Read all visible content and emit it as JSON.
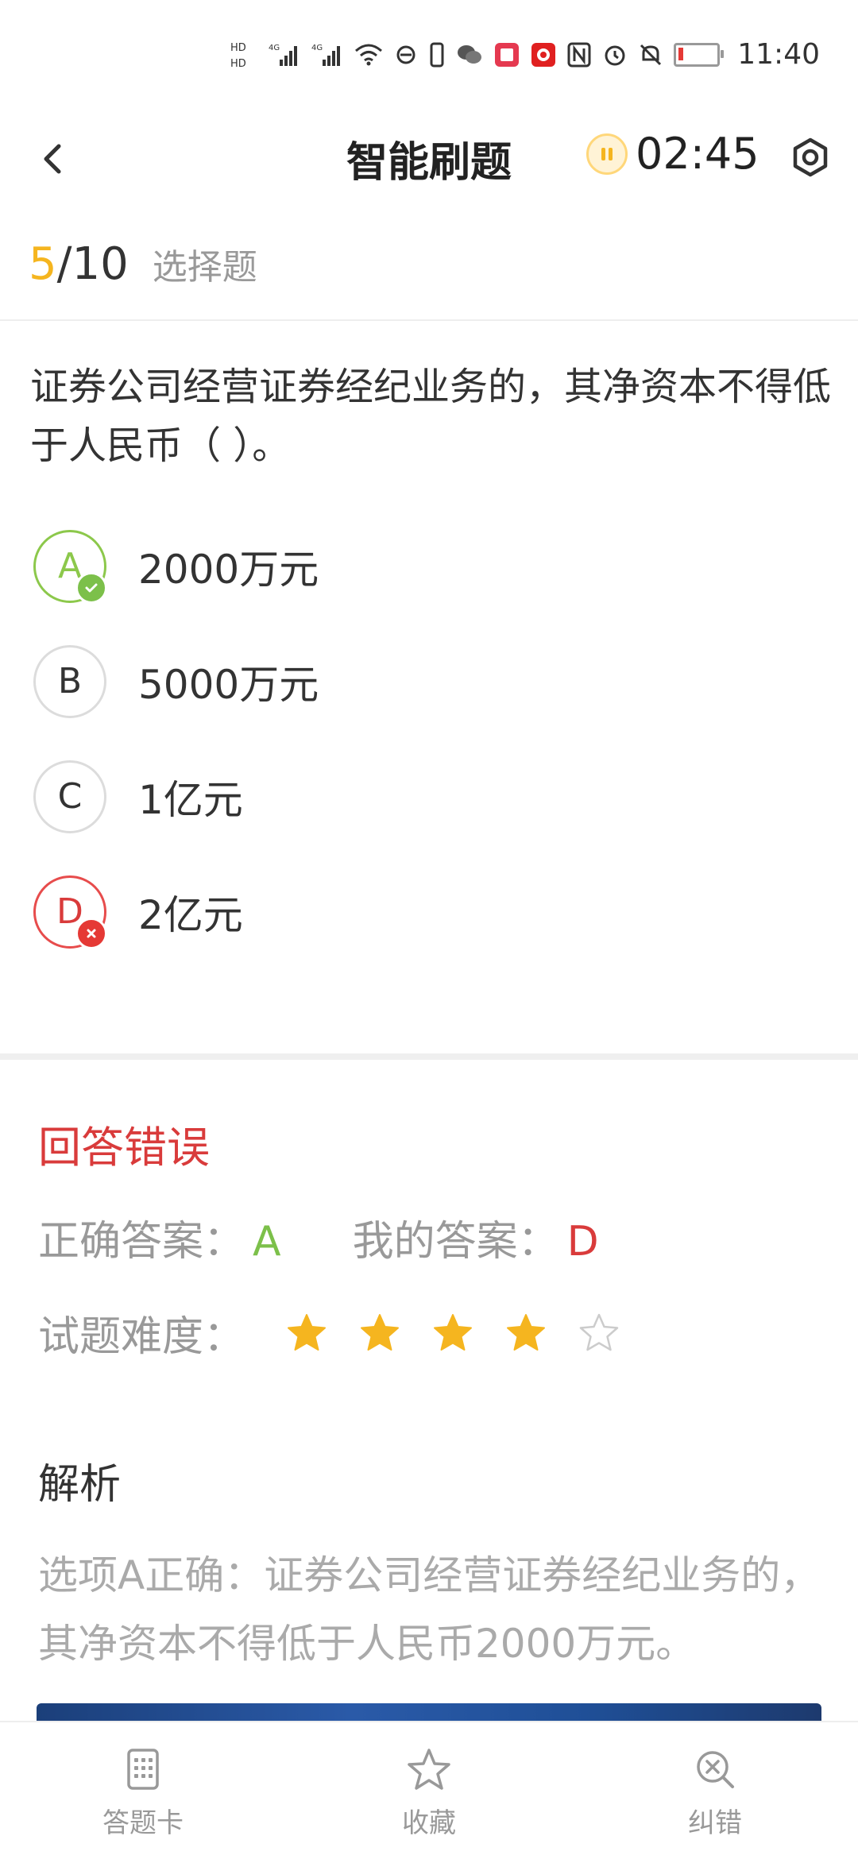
{
  "status_bar": {
    "time": "11:40",
    "icons": [
      "hd1-hd2-icon",
      "4g-signal-icon",
      "4g-signal-icon",
      "wifi-icon",
      "data-saver-icon",
      "phone-icon",
      "wechat-icon",
      "book-app-icon",
      "app-icon",
      "nfc-icon",
      "alarm-icon",
      "mute-icon",
      "battery-icon"
    ]
  },
  "header": {
    "title": "智能刷题",
    "timer": "02:45"
  },
  "progress": {
    "current": "5",
    "separator": "/",
    "total": "10",
    "type": "选择题"
  },
  "question": {
    "text": "证券公司经营证券经纪业务的，其净资本不得低于人民币（ ）。",
    "options": [
      {
        "letter": "A",
        "text": "2000万元",
        "state": "correct"
      },
      {
        "letter": "B",
        "text": "5000万元",
        "state": "normal"
      },
      {
        "letter": "C",
        "text": "1亿元",
        "state": "normal"
      },
      {
        "letter": "D",
        "text": "2亿元",
        "state": "wrong"
      }
    ]
  },
  "result": {
    "title": "回答错误",
    "correct_label": "正确答案：",
    "correct_answer": "A",
    "mine_label": "我的答案：",
    "mine_answer": "D",
    "difficulty_label": "试题难度：",
    "difficulty_stars": 4,
    "difficulty_max": 5
  },
  "analysis": {
    "title": "解析",
    "text": "选项A正确：证券公司经营证券经纪业务的，其净资本不得低于人民币2000万元。"
  },
  "bottom_bar": {
    "tabs": [
      {
        "label": "答题卡",
        "icon": "answer-card-icon"
      },
      {
        "label": "收藏",
        "icon": "star-icon"
      },
      {
        "label": "纠错",
        "icon": "error-report-icon"
      }
    ]
  },
  "colors": {
    "accent_yellow": "#f5b51f",
    "correct_green": "#7cc04a",
    "wrong_red": "#d93b3b"
  }
}
